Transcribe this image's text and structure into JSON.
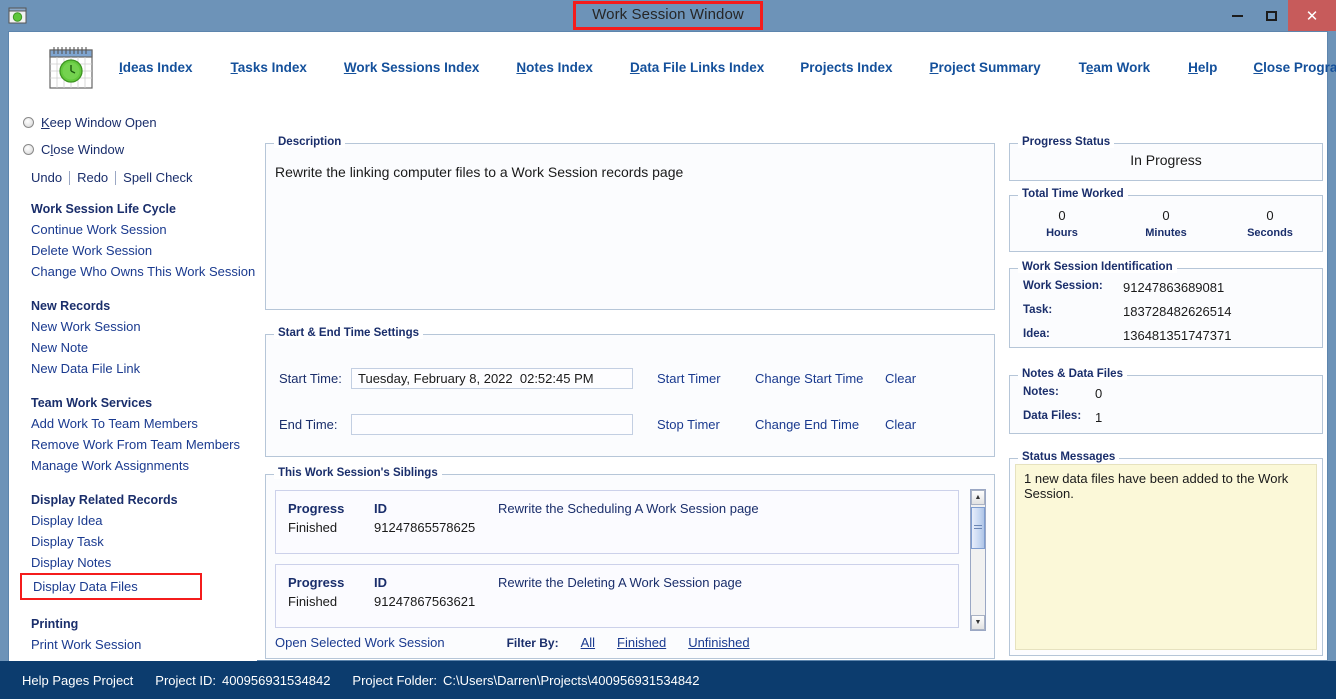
{
  "window": {
    "title": "Work Session Window",
    "icon": "calendar-clock-icon",
    "minimize_label": "",
    "maximize_label": "",
    "close_label": "✕",
    "titlebar_color": "#6d93b8",
    "highlight_color": "#f41c1c",
    "close_button_color": "#c75b5b"
  },
  "menu": {
    "items": [
      {
        "label": "Ideas Index",
        "accel": "I"
      },
      {
        "label": "Tasks Index",
        "accel": "T"
      },
      {
        "label": "Work Sessions Index",
        "accel": "W"
      },
      {
        "label": "Notes Index",
        "accel": "N"
      },
      {
        "label": "Data File Links Index",
        "accel": "D"
      },
      {
        "label": "Projects Index",
        "accel": ""
      },
      {
        "label": "Project Summary",
        "accel": "P"
      },
      {
        "label": "Team Work",
        "accel": "e"
      },
      {
        "label": "Help",
        "accel": "H"
      },
      {
        "label": "Close Program",
        "accel": "C"
      }
    ]
  },
  "sidebar": {
    "radios": [
      {
        "label": "Keep Window Open",
        "accel": "K",
        "selected": false
      },
      {
        "label": "Close Window",
        "accel": "l",
        "selected": false
      }
    ],
    "edit_actions": [
      "Undo",
      "Redo",
      "Spell Check"
    ],
    "groups": [
      {
        "heading": "Work Session Life Cycle",
        "links": [
          "Continue Work Session",
          "Delete Work Session",
          "Change Who Owns This Work Session"
        ]
      },
      {
        "heading": "New Records",
        "links": [
          "New Work Session",
          "New Note",
          "New Data File Link"
        ]
      },
      {
        "heading": "Team Work Services",
        "links": [
          "Add Work To Team Members",
          "Remove Work From Team Members",
          "Manage Work Assignments"
        ]
      },
      {
        "heading": "Display Related Records",
        "links": [
          "Display Idea",
          "Display Task",
          "Display Notes",
          "Display Data Files"
        ],
        "highlighted_link": "Display Data Files"
      },
      {
        "heading": "Printing",
        "links": [
          "Print Work Session"
        ]
      }
    ]
  },
  "description": {
    "legend": "Description",
    "text": "Rewrite the  linking computer files to a Work Session records page"
  },
  "time_settings": {
    "legend": "Start & End Time Settings",
    "start_label": "Start Time:",
    "start_value": "Tuesday, February 8, 2022  02:52:45 PM",
    "start_placeholder": "",
    "start_actions": [
      "Start Timer",
      "Change Start Time",
      "Clear"
    ],
    "end_label": "End Time:",
    "end_value": "",
    "end_placeholder": "",
    "end_actions": [
      "Stop Timer",
      "Change End Time",
      "Clear"
    ]
  },
  "siblings": {
    "legend": "This Work Session's Siblings",
    "col_progress": "Progress",
    "col_id": "ID",
    "rows": [
      {
        "progress": "Finished",
        "id": "91247865578625",
        "description": "Rewrite the Scheduling A Work Session page"
      },
      {
        "progress": "Finished",
        "id": "91247867563621",
        "description": "Rewrite the Deleting A Work Session page"
      }
    ],
    "open_label": "Open Selected Work Session",
    "filter_label": "Filter By:",
    "filter_options": [
      "All",
      "Finished",
      "Unfinished"
    ],
    "scroll_up_icon": "caret-up-icon",
    "scroll_down_icon": "caret-down-icon"
  },
  "progress_status": {
    "legend": "Progress Status",
    "value": "In Progress"
  },
  "total_time_worked": {
    "legend": "Total Time Worked",
    "cells": [
      {
        "value": "0",
        "unit": "Hours"
      },
      {
        "value": "0",
        "unit": "Minutes"
      },
      {
        "value": "0",
        "unit": "Seconds"
      }
    ]
  },
  "identification": {
    "legend": "Work Session Identification",
    "rows": [
      {
        "key": "Work Session:",
        "value": "91247863689081"
      },
      {
        "key": "Task:",
        "value": "183728482626514"
      },
      {
        "key": "Idea:",
        "value": "136481351747371"
      }
    ]
  },
  "notes_data_files": {
    "legend": "Notes & Data Files",
    "rows": [
      {
        "key": "Notes:",
        "value": "0"
      },
      {
        "key": "Data Files:",
        "value": "1"
      }
    ]
  },
  "status_messages": {
    "legend": "Status Messages",
    "message": "1 new data files have been added to the Work Session.",
    "background": "#fbf8d8"
  },
  "statusbar": {
    "project_name": "Help Pages Project",
    "project_id_label": "Project ID:",
    "project_id": "400956931534842",
    "project_folder_label": "Project Folder:",
    "project_folder": "C:\\Users\\Darren\\Projects\\400956931534842",
    "background": "#0c3c6e"
  }
}
